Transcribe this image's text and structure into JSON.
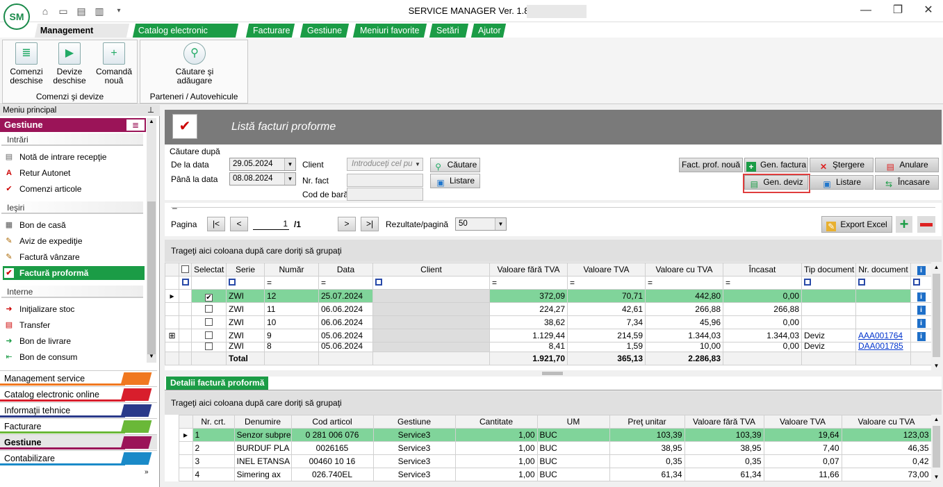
{
  "window": {
    "title": "SERVICE MANAGER Ver. 1.8.5",
    "logo_text": "SM"
  },
  "ribbon_tabs": [
    "Management service",
    "Catalog electronic online",
    "Facturare",
    "Gestiune",
    "Meniuri favorite",
    "Setări",
    "Ajutor"
  ],
  "ribbon": {
    "group1_label": "Comenzi şi devize",
    "btn_comenzi_l1": "Comenzi",
    "btn_comenzi_l2": "deschise",
    "btn_devize_l1": "Devize",
    "btn_devize_l2": "deschise",
    "btn_comanda_l1": "Comandă",
    "btn_comanda_l2": "nouă",
    "group2_label": "Parteneri / Autovehicule",
    "btn_cautare_l1": "Căutare şi",
    "btn_cautare_l2": "adăugare"
  },
  "leftmenu": {
    "header": "Meniu principal",
    "pin": "ᵖ",
    "category": "Gestiune",
    "sections": {
      "intrari": "Intrări",
      "iesiri": "Ieşiri",
      "interne": "Interne"
    },
    "intrari_items": [
      "Notă de intrare recepţie",
      "Retur Autonet",
      "Comenzi articole"
    ],
    "iesiri_items": [
      "Bon de casă",
      "Aviz de expediţie",
      "Factură vânzare",
      "Factură proformă"
    ],
    "interne_items": [
      "Iniţializare stoc",
      "Transfer",
      "Bon de livrare",
      "Bon de consum"
    ],
    "nav": [
      "Management service",
      "Catalog electronic online",
      "Informaţii tehnice",
      "Facturare",
      "Gestiune",
      "Contabilizare"
    ]
  },
  "main": {
    "title": "Listă facturi proforme",
    "search_group": "Căutare după",
    "de_la_data_label": "De la data",
    "de_la_data": "29.05.2024",
    "pana_la_data_label": "Până la data",
    "pana_la_data": "08.08.2024",
    "client_label": "Client",
    "client_placeholder": "Introduceţi cel pu",
    "nr_fact_label": "Nr. fact",
    "cod_bara_label": "Cod de bară",
    "btn_cautare": "Căutare",
    "btn_listare": "Listare",
    "btn_fact_noua": "Fact. prof. nouă",
    "btn_gen_factura": "Gen. factura",
    "btn_stergere": "Ştergere",
    "btn_anulare": "Anulare",
    "btn_gen_deviz": "Gen. deviz",
    "btn_listare2": "Listare",
    "btn_incasare": "Încasare",
    "collapse": "–",
    "pagina_label": "Pagina",
    "page_value": "1",
    "page_total": "/1",
    "nav_first": "|<",
    "nav_prev": "<",
    "nav_next": ">",
    "nav_last": ">|",
    "rezultate_label": "Rezultate/pagină",
    "rezultate_value": "50",
    "btn_export": "Export Excel",
    "group_hint": "Trageţi aici coloana după care doriţi să grupaţi"
  },
  "invoices": {
    "columns": [
      "Selectat",
      "Serie",
      "Număr",
      "Data",
      "Client",
      "Valoare fără TVA",
      "Valoare TVA",
      "Valoare cu TVA",
      "Încasat",
      "Tip document",
      "Nr. document"
    ],
    "filter_eq": "=",
    "rows": [
      {
        "serie": "ZWI",
        "numar": "12",
        "data": "25.07.2024",
        "vfara": "372,09",
        "vtva": "70,71",
        "vcu": "442,80",
        "incasat": "0,00",
        "tip": "",
        "nrdoc": "",
        "checked": "✔"
      },
      {
        "serie": "ZWI",
        "numar": "11",
        "data": "06.06.2024",
        "vfara": "224,27",
        "vtva": "42,61",
        "vcu": "266,88",
        "incasat": "266,88",
        "tip": "",
        "nrdoc": "",
        "checked": ""
      },
      {
        "serie": "ZWI",
        "numar": "10",
        "data": "06.06.2024",
        "vfara": "38,62",
        "vtva": "7,34",
        "vcu": "45,96",
        "incasat": "0,00",
        "tip": "",
        "nrdoc": "",
        "checked": ""
      },
      {
        "serie": "ZWI",
        "numar": "9",
        "data": "05.06.2024",
        "vfara": "1.129,44",
        "vtva": "214,59",
        "vcu": "1.344,03",
        "incasat": "1.344,03",
        "tip": "Deviz",
        "nrdoc": "AAA001764",
        "checked": ""
      },
      {
        "serie": "ZWI",
        "numar": "8",
        "data": "05.06.2024",
        "vfara": "8,41",
        "vtva": "1,59",
        "vcu": "10,00",
        "incasat": "0,00",
        "tip": "Deviz",
        "nrdoc": "DAA001785",
        "checked": ""
      }
    ],
    "total_label": "Total",
    "total_vfara": "1.921,70",
    "total_vtva": "365,13",
    "total_vcu": "2.286,83"
  },
  "details": {
    "tab": "Detalii factură proformă",
    "columns": [
      "Nr. crt.",
      "Denumire",
      "Cod articol",
      "Gestiune",
      "Cantitate",
      "UM",
      "Preţ unitar",
      "Valoare fără TVA",
      "Valoare TVA",
      "Valoare cu TVA"
    ],
    "rows": [
      {
        "nr": "1",
        "den": "Senzor subpre",
        "cod": "0 281 006 076",
        "gest": "Service3",
        "cant": "1,00",
        "um": "BUC",
        "pret": "103,39",
        "vfara": "103,39",
        "vtva": "19,64",
        "vcu": "123,03"
      },
      {
        "nr": "2",
        "den": "BURDUF PLA",
        "cod": "0026165",
        "gest": "Service3",
        "cant": "1,00",
        "um": "BUC",
        "pret": "38,95",
        "vfara": "38,95",
        "vtva": "7,40",
        "vcu": "46,35"
      },
      {
        "nr": "3",
        "den": "INEL ETANSA",
        "cod": "00460 10 16",
        "gest": "Service3",
        "cant": "1,00",
        "um": "BUC",
        "pret": "0,35",
        "vfara": "0,35",
        "vtva": "0,07",
        "vcu": "0,42"
      },
      {
        "nr": "4",
        "den": "Simering ax",
        "cod": "026.740EL",
        "gest": "Service3",
        "cant": "1,00",
        "um": "BUC",
        "pret": "61,34",
        "vfara": "61,34",
        "vtva": "11,66",
        "vcu": "73,00"
      }
    ]
  },
  "colors": {
    "accent": "#1b9c46",
    "selected_row": "#80d49a",
    "highlight": "#e03c3c"
  }
}
